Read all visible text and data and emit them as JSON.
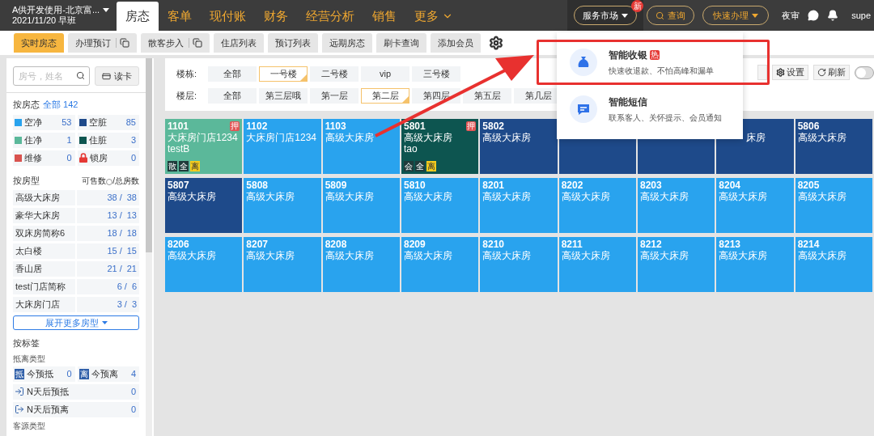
{
  "header": {
    "hotel": "A供开发使用-北京富...",
    "shift": "2021/11/20 早班",
    "nav": [
      {
        "label": "房态",
        "selected": true
      },
      {
        "label": "客单",
        "selected": false
      },
      {
        "label": "现付账",
        "selected": false
      },
      {
        "label": "财务",
        "selected": false
      },
      {
        "label": "经营分析",
        "selected": false
      },
      {
        "label": "销售",
        "selected": false
      },
      {
        "label": "更多",
        "selected": false
      }
    ],
    "market": {
      "label": "服务市场",
      "badge": "新"
    },
    "query": "查询",
    "quick": "快速办理",
    "night_audit": "夜审",
    "user": "supe"
  },
  "subtabs": [
    {
      "label": "实时房态",
      "selected": true,
      "copy": false
    },
    {
      "label": "办理预订",
      "selected": false,
      "copy": true
    },
    {
      "label": "散客步入",
      "selected": false,
      "copy": true
    },
    {
      "label": "住店列表",
      "selected": false,
      "copy": false
    },
    {
      "label": "预订列表",
      "selected": false,
      "copy": false
    },
    {
      "label": "远期房态",
      "selected": false,
      "copy": false
    },
    {
      "label": "刷卡查询",
      "selected": false,
      "copy": false
    },
    {
      "label": "添加会员",
      "selected": false,
      "copy": false
    }
  ],
  "dropdown": {
    "items": [
      {
        "kind": "money",
        "title": "智能收银",
        "badge": "热",
        "desc": "快速收退款、不怕高峰和漏单",
        "highlighted": true
      },
      {
        "kind": "message",
        "title": "智能短信",
        "desc": "联系客人、关怀提示、会员通知",
        "highlighted": false
      }
    ]
  },
  "sidebar": {
    "search": {
      "placeholder": "房号，姓名"
    },
    "card_button": "读卡",
    "status": {
      "label": "按房态",
      "all": "全部 142",
      "items": [
        {
          "kind": "swatch",
          "label": "空净",
          "count": "53",
          "color": "#29a3ee"
        },
        {
          "kind": "swatch",
          "label": "空脏",
          "count": "85",
          "color": "#1e4a8a"
        },
        {
          "kind": "swatch",
          "label": "住净",
          "count": "1",
          "color": "#5bb89a"
        },
        {
          "kind": "swatch",
          "label": "住脏",
          "count": "3",
          "color": "#0d5550"
        },
        {
          "kind": "swatch",
          "label": "维修",
          "count": "0",
          "color": "#d9534f"
        },
        {
          "kind": "lock",
          "label": "锁房",
          "count": "0",
          "color": "#e53935"
        }
      ]
    },
    "room_types": {
      "label": "按房型",
      "header_available": "可售数",
      "header_total": "/总房数",
      "items": [
        {
          "name": "高级大床房",
          "available": "38 /",
          "total": "38"
        },
        {
          "name": "豪华大床房",
          "available": "13 /",
          "total": "13"
        },
        {
          "name": "双床房简称6",
          "available": "18 /",
          "total": "18"
        },
        {
          "name": "太白楼",
          "available": "15 /",
          "total": "15"
        },
        {
          "name": "香山居",
          "available": "21 /",
          "total": "21"
        },
        {
          "name": "test门店简称",
          "available": "6 /",
          "total": "6"
        },
        {
          "name": "大床房门店",
          "available": "3 /",
          "total": "3"
        }
      ]
    },
    "expand": "展开更多房型",
    "tags": {
      "label": "按标签",
      "group": "抵离类型",
      "items": [
        {
          "kind": "badge",
          "icon": "抵",
          "label": "今预抵",
          "count": "0",
          "wide": false
        },
        {
          "kind": "badge",
          "icon": "离",
          "label": "今预离",
          "count": "4",
          "wide": false
        },
        {
          "kind": "arrival",
          "label": "N天后预抵",
          "count": "0",
          "wide": true
        },
        {
          "kind": "departure",
          "label": "N天后预离",
          "count": "0",
          "wide": true
        }
      ]
    },
    "source_group": "客源类型"
  },
  "filters": [
    {
      "label": "楼栋:",
      "options": [
        {
          "label": "全部",
          "selected": false
        },
        {
          "label": "一号楼",
          "selected": true
        },
        {
          "label": "二号楼",
          "selected": false
        },
        {
          "label": "vip",
          "selected": false
        },
        {
          "label": "三号楼",
          "selected": false
        }
      ]
    },
    {
      "label": "楼层:",
      "options": [
        {
          "label": "全部",
          "selected": false
        },
        {
          "label": "第三层哦",
          "selected": false
        },
        {
          "label": "第一层",
          "selected": false
        },
        {
          "label": "第二层",
          "selected": true
        },
        {
          "label": "第四层",
          "selected": false
        },
        {
          "label": "第五层",
          "selected": false
        },
        {
          "label": "第几层",
          "selected": false
        }
      ]
    }
  ],
  "toolbar": {
    "settings": "设置",
    "refresh": "刷新",
    "toggle_on": false
  },
  "rooms": [
    {
      "number": "1101",
      "type": "大床房门店1234",
      "guest": "testB",
      "color": "#5bb89a",
      "deposit": "押",
      "tags": [
        {
          "label": "散",
          "kind": "dark"
        },
        {
          "label": "全",
          "kind": "dark"
        },
        {
          "label": "离",
          "kind": "yellow"
        }
      ]
    },
    {
      "number": "1102",
      "type": "大床房门店1234",
      "color": "#29a3ee"
    },
    {
      "number": "1103",
      "type": "高级大床房",
      "color": "#29a3ee"
    },
    {
      "number": "5801",
      "type": "高级大床房",
      "guest": "tao",
      "color": "#0d5550",
      "deposit": "押",
      "tags": [
        {
          "label": "会",
          "kind": "dark"
        },
        {
          "label": "全",
          "kind": "dark"
        },
        {
          "label": "离",
          "kind": "yellow"
        }
      ]
    },
    {
      "number": "5802",
      "type": "高级大床房",
      "color": "#1e4a8a"
    },
    {
      "color": "#1e4a8a"
    },
    {
      "color": "#1e4a8a"
    },
    {
      "type": "床房",
      "color": "#1e4a8a"
    },
    {
      "number": "5806",
      "type": "高级大床房",
      "color": "#1e4a8a"
    },
    {
      "number": "5807",
      "type": "高级大床房",
      "color": "#1e4a8a"
    },
    {
      "number": "5808",
      "type": "高级大床房",
      "color": "#29a3ee"
    },
    {
      "number": "5809",
      "type": "高级大床房",
      "color": "#29a3ee"
    },
    {
      "number": "5810",
      "type": "高级大床房",
      "color": "#29a3ee"
    },
    {
      "number": "8201",
      "type": "高级大床房",
      "color": "#29a3ee"
    },
    {
      "number": "8202",
      "type": "高级大床房",
      "color": "#29a3ee"
    },
    {
      "number": "8203",
      "type": "高级大床房",
      "color": "#29a3ee"
    },
    {
      "number": "8204",
      "type": "高级大床房",
      "color": "#29a3ee"
    },
    {
      "number": "8205",
      "type": "高级大床房",
      "color": "#29a3ee"
    },
    {
      "number": "8206",
      "type": "高级大床房",
      "color": "#29a3ee"
    },
    {
      "number": "8207",
      "type": "高级大床房",
      "color": "#29a3ee"
    },
    {
      "number": "8208",
      "type": "高级大床房",
      "color": "#29a3ee"
    },
    {
      "number": "8209",
      "type": "高级大床房",
      "color": "#29a3ee"
    },
    {
      "number": "8210",
      "type": "高级大床房",
      "color": "#29a3ee"
    },
    {
      "number": "8211",
      "type": "高级大床房",
      "color": "#29a3ee"
    },
    {
      "number": "8212",
      "type": "高级大床房",
      "color": "#29a3ee"
    },
    {
      "number": "8213",
      "type": "高级大床房",
      "color": "#29a3ee"
    },
    {
      "number": "8214",
      "type": "高级大床房",
      "color": "#29a3ee"
    }
  ]
}
